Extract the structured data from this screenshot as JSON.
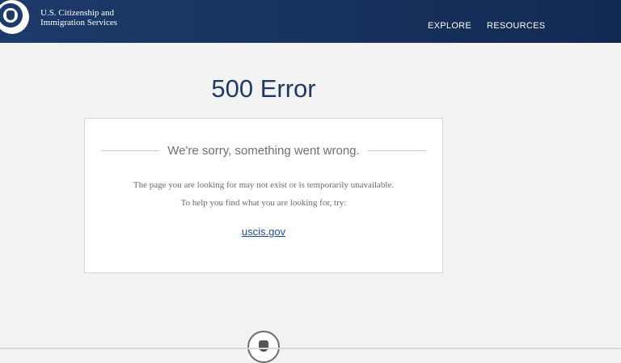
{
  "header": {
    "agency_line1": "U.S. Citizenship and",
    "agency_line2": "Immigration Services",
    "nav": [
      "EXPLORE",
      "RESOURCES"
    ],
    "bg_color": "#1c3a6b",
    "logo_icon": "dhs-seal-icon"
  },
  "main": {
    "title": "500 Error",
    "sorry": "We're sorry, something went wrong.",
    "message_1": "The page you are looking for may not exist or is temporarily unavailable.",
    "message_2": "To help you find what you are looking for, try:",
    "link": "uscis.gov",
    "link_color": "#1e4d8f",
    "title_color": "#1e3a66"
  },
  "footer": {
    "logo_icon": "dhs-seal-icon"
  }
}
